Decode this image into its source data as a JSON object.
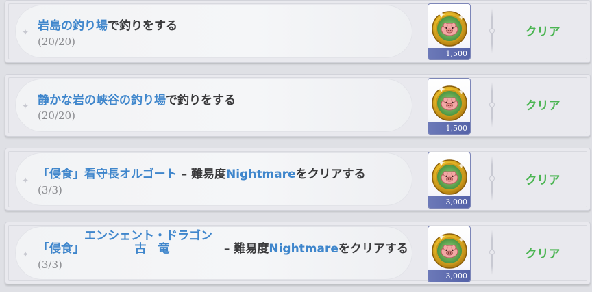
{
  "colors": {
    "highlight_blue": "#3f86cc",
    "clear_green": "#4bb552",
    "text_dark": "#3a3a3c",
    "reward_band": "#5d6aae"
  },
  "quests": [
    {
      "title_highlight": "岩島の釣り場",
      "title_rest": "で釣りをする",
      "progress": "(20/20)",
      "reward_icon": "pig-gold-coin-icon",
      "reward_amount": "1,500",
      "status": "クリア"
    },
    {
      "title_highlight": "静かな岩の峡谷の釣り場",
      "title_rest": "で釣りをする",
      "progress": "(20/20)",
      "reward_icon": "pig-gold-coin-icon",
      "reward_amount": "1,500",
      "status": "クリア"
    },
    {
      "title_highlight": "「侵食」看守長オルゴート",
      "title_dash": " – 難易度",
      "title_difficulty": "Nightmare",
      "title_rest": "をクリアする",
      "progress": "(3/3)",
      "reward_icon": "pig-gold-coin-icon",
      "reward_amount": "3,000",
      "status": "クリア"
    },
    {
      "title_prefix": "「侵食」",
      "title_ruby_top": "エンシェント・ドラゴン",
      "title_ruby_base": "古　竜",
      "title_dash": " – 難易度",
      "title_difficulty": "Nightmare",
      "title_rest": "をクリアする",
      "progress": "(3/3)",
      "reward_icon": "pig-gold-coin-icon",
      "reward_amount": "3,000",
      "status": "クリア"
    }
  ]
}
